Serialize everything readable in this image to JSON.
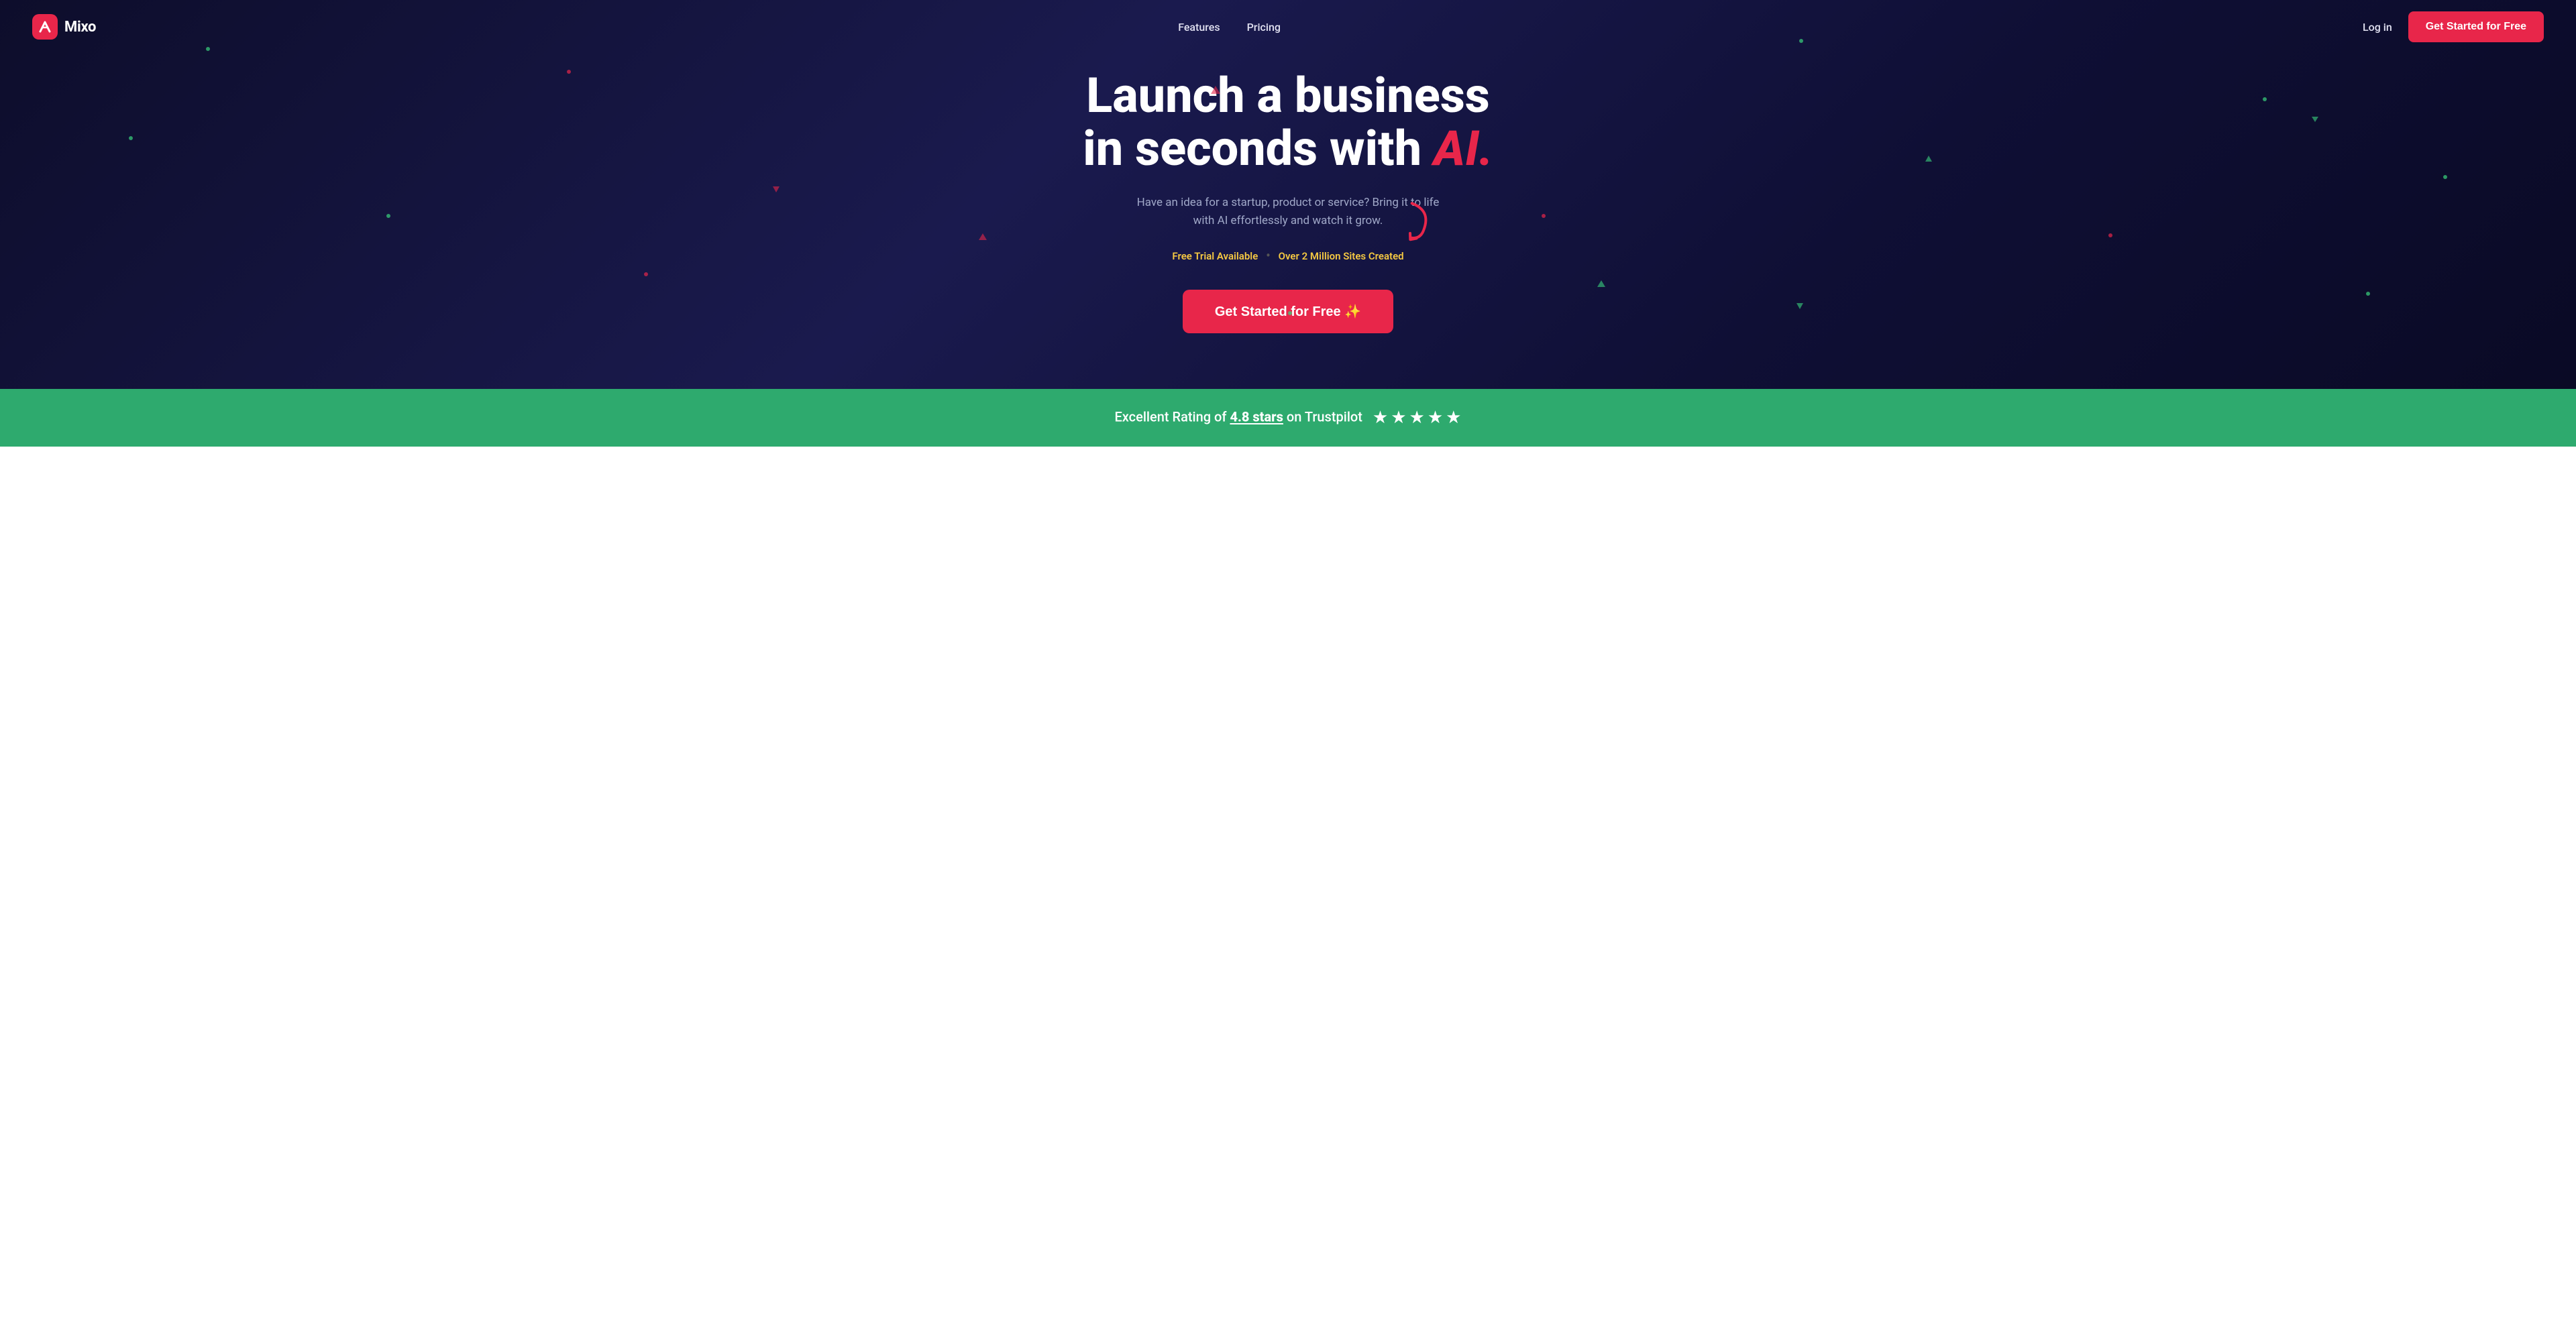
{
  "nav": {
    "logo_text": "Mixo",
    "links": [
      {
        "label": "Features",
        "id": "features"
      },
      {
        "label": "Pricing",
        "id": "pricing"
      }
    ],
    "login_label": "Log in",
    "cta_label": "Get Started for Free"
  },
  "hero": {
    "headline_line1": "Launch a business",
    "headline_line2": "in seconds with",
    "headline_ai": "AI.",
    "subtext": "Have an idea for a startup, product or service? Bring it to life with AI effortlessly and watch it grow.",
    "badge_free": "Free Trial Available",
    "badge_dot": "•",
    "badge_sites": "Over 2 Million Sites Created",
    "cta_label": "Get Started for Free ✨"
  },
  "trustpilot": {
    "prefix": "Excellent Rating of ",
    "rating": "4.8 stars",
    "suffix": " on Trustpilot",
    "stars_count": 5
  }
}
